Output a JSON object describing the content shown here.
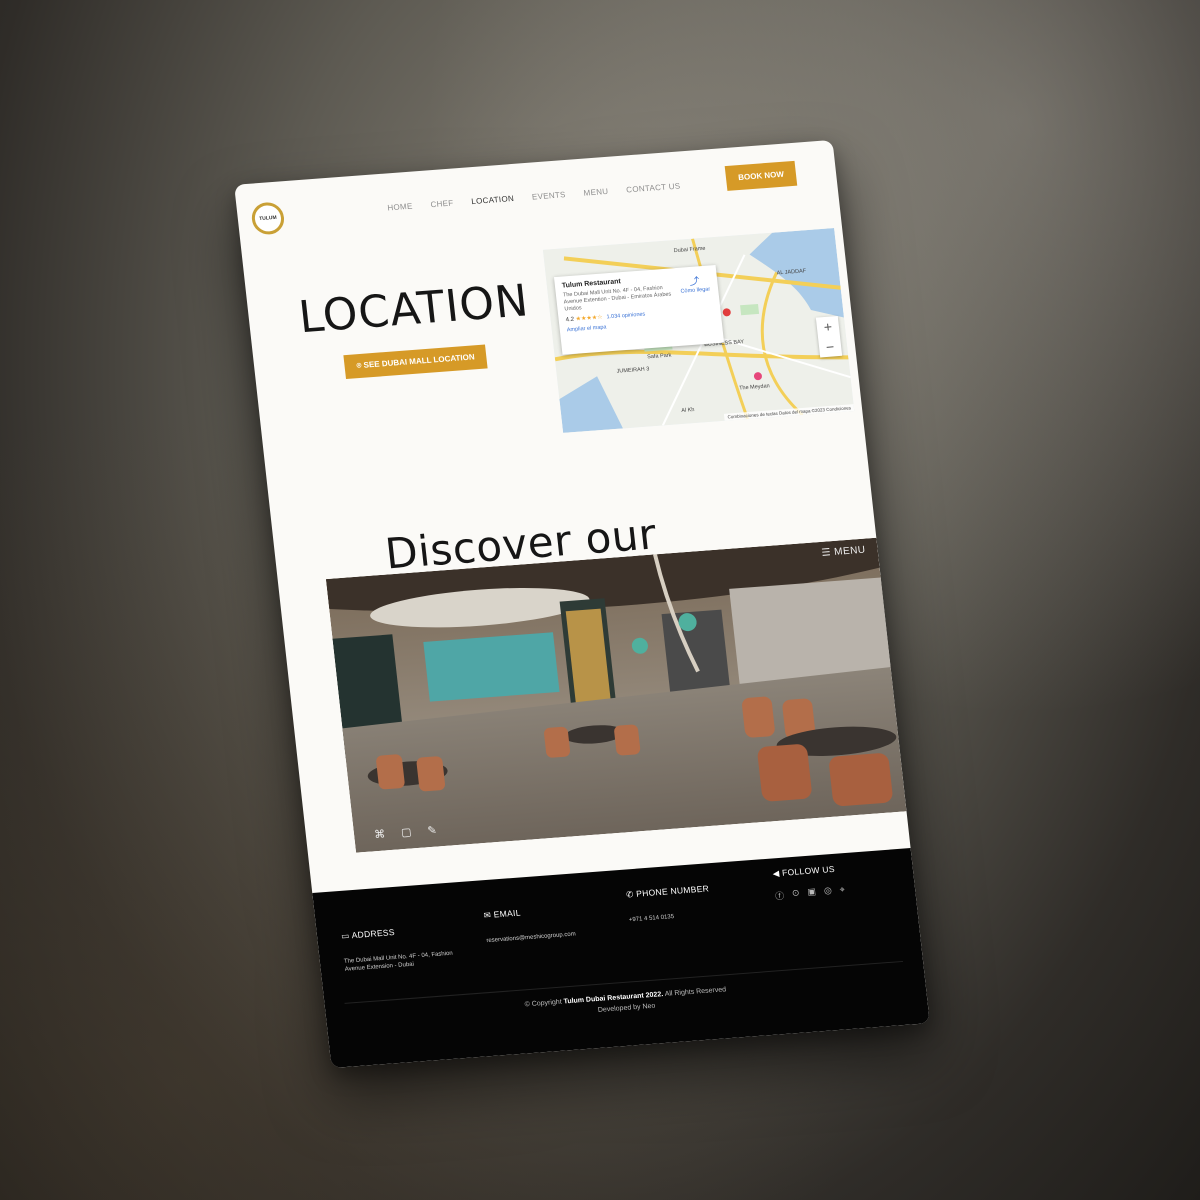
{
  "nav": {
    "items": [
      "HOME",
      "CHEF",
      "LOCATION",
      "EVENTS",
      "MENU",
      "CONTACT US"
    ],
    "active": "LOCATION",
    "book_label": "BOOK NOW"
  },
  "logo_text": "TULUM",
  "location": {
    "title": "LOCATION",
    "button_label": "SEE DUBAI MALL LOCATION"
  },
  "map": {
    "place_name": "Tulum Restaurant",
    "address": "The Dubai Mall Unit No. 4F - 04, Fashion Avenue Extention - Dubai - Emiratos Árabes Unidos",
    "rating": "4.2",
    "stars": "★★★★☆",
    "reviews": "1.034 opiniones",
    "directions": "Cómo llegar",
    "expand": "Ampliar el mapa",
    "zoom_in": "+",
    "zoom_out": "−",
    "footer": "Combinaciones de teclas   Datos del mapa ©2023   Condiciones",
    "labels": [
      "Dubai Frame",
      "AL JADDAF",
      "Safa Park",
      "BUSINESS BAY",
      "JUMEIRAH 3",
      "The Meydan",
      "Al Kh"
    ]
  },
  "discover": {
    "title": "Discover our restaurant.",
    "tour_menu": "MENU"
  },
  "footer": {
    "address_label": "ADDRESS",
    "address_value": "The Dubai Mall Unit No. 4F - 04, Fashion Avenue Extension - Dubai",
    "email_label": "EMAIL",
    "email_value": "reservations@meshicogroup.com",
    "phone_label": "PHONE NUMBER",
    "phone_value": "+971 4 514 0135",
    "follow_label": "FOLLOW US",
    "copyright_prefix": "© Copyright",
    "copyright_brand": "Tulum Dubai Restaurant 2022.",
    "copyright_suffix": "All Rights Reserved",
    "developed": "Developed by Neo"
  },
  "colors": {
    "accent": "#d69a27",
    "footer_bg": "#050505"
  }
}
